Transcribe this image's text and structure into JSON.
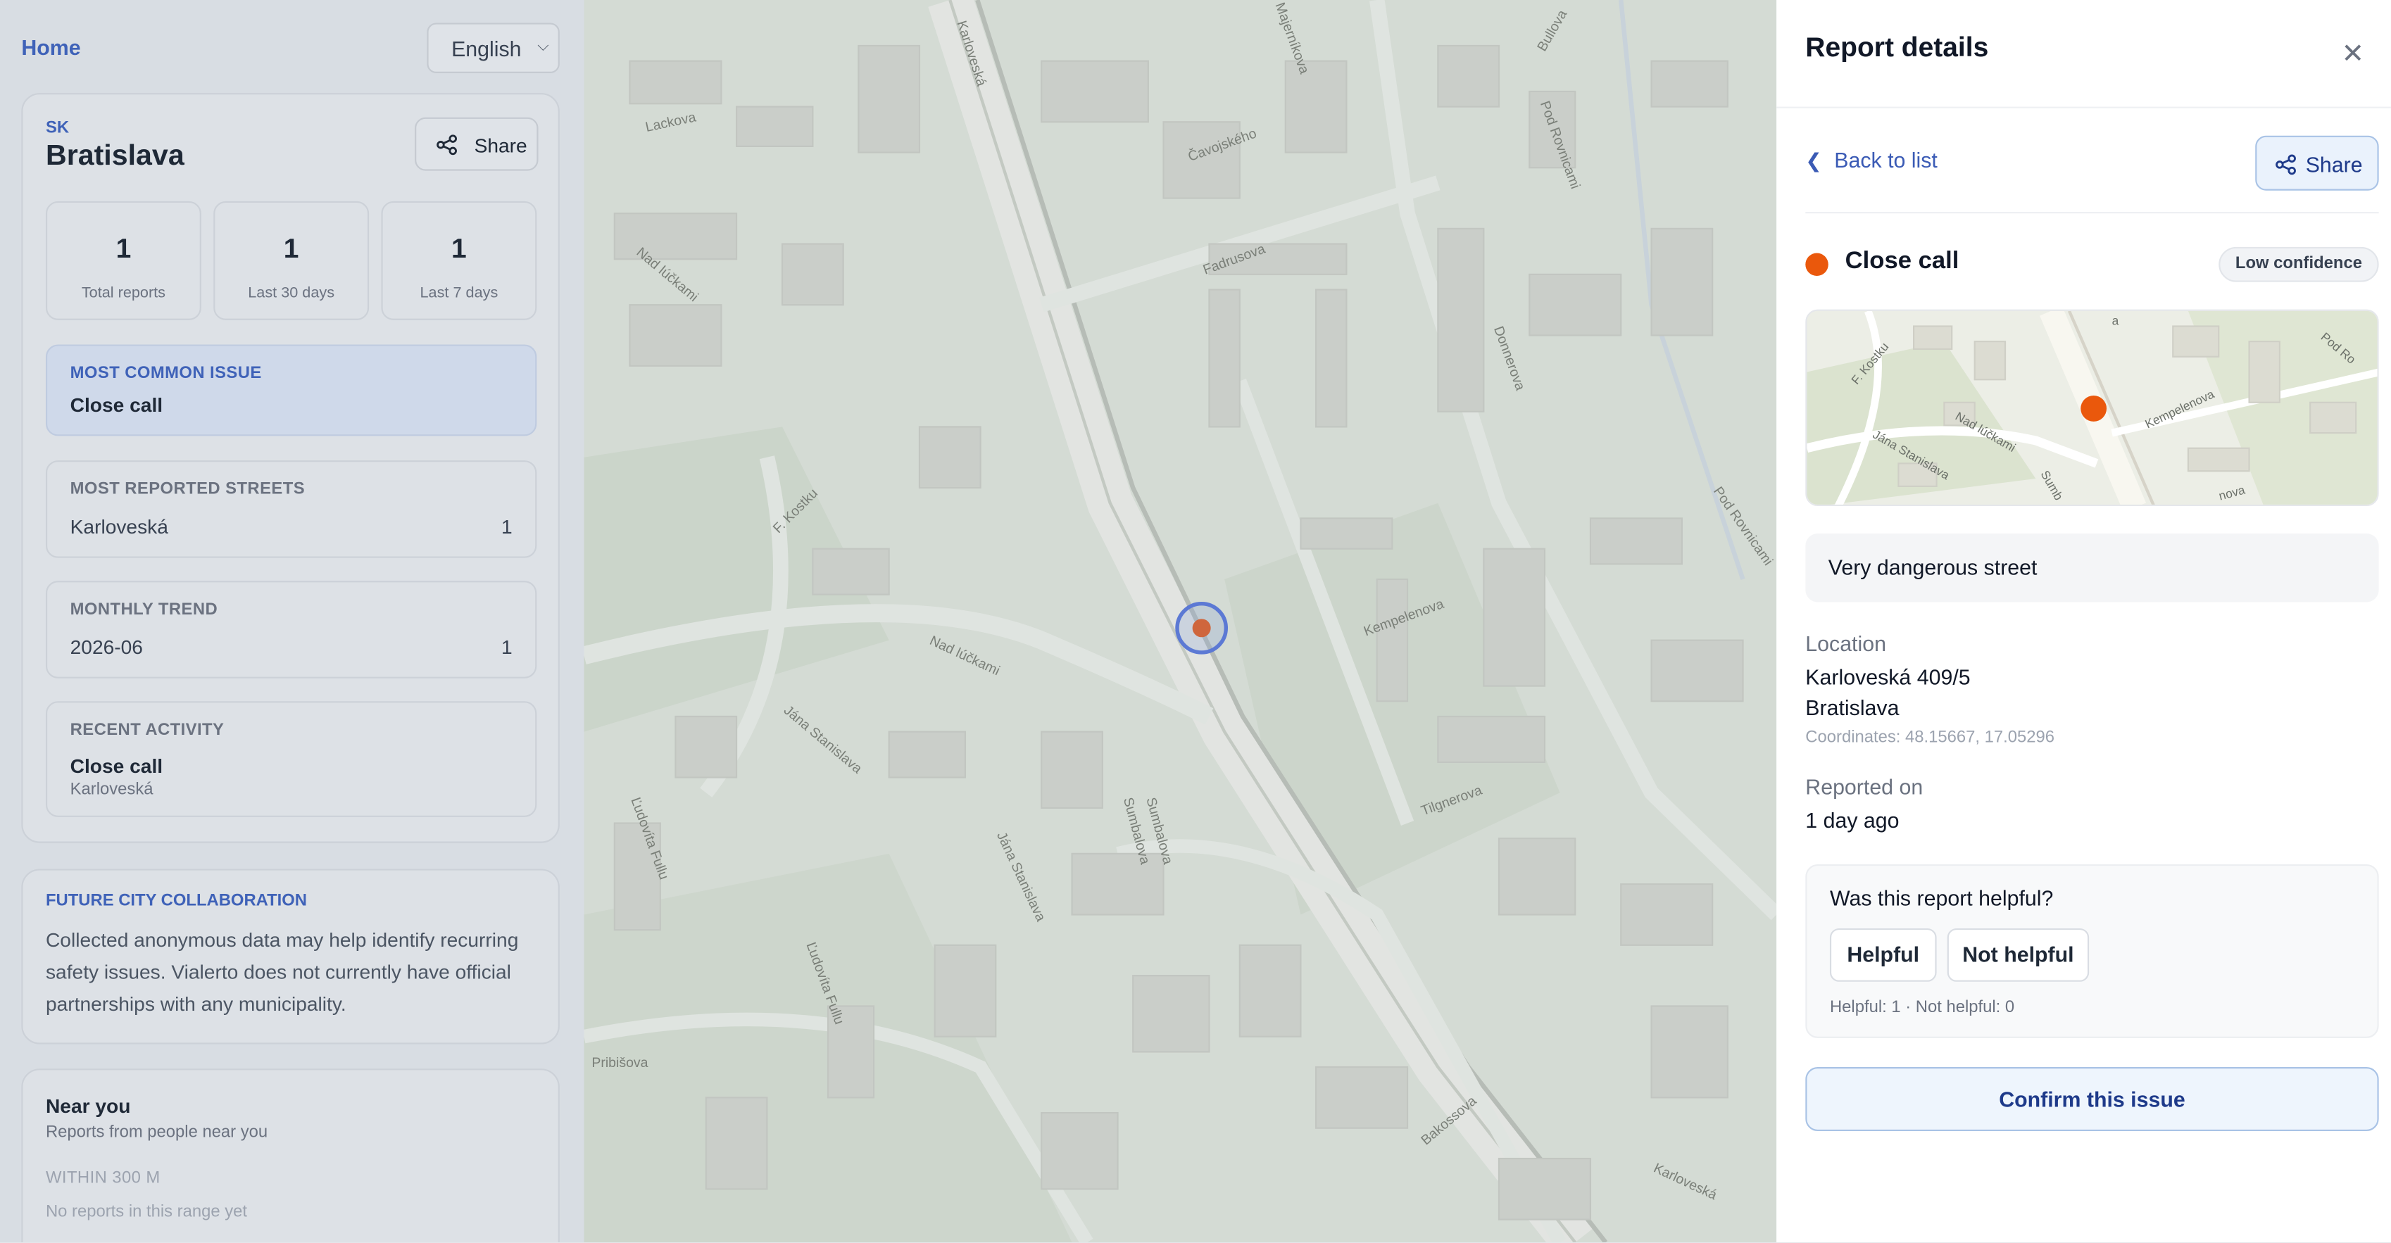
{
  "app": {
    "home_label": "Home",
    "language": "English"
  },
  "city": {
    "country_code": "SK",
    "name": "Bratislava",
    "share_label": "Share",
    "stats": [
      {
        "value": "1",
        "label": "Total reports"
      },
      {
        "value": "1",
        "label": "Last 30 days"
      },
      {
        "value": "1",
        "label": "Last 7 days"
      }
    ],
    "most_common_issue": {
      "title": "MOST COMMON ISSUE",
      "value": "Close call"
    },
    "most_reported_streets": {
      "title": "MOST REPORTED STREETS",
      "rows": [
        {
          "name": "Karloveská",
          "count": "1"
        }
      ]
    },
    "monthly_trend": {
      "title": "MONTHLY TREND",
      "rows": [
        {
          "name": "2026-06",
          "count": "1"
        }
      ]
    },
    "recent_activity": {
      "title": "RECENT ACTIVITY",
      "items": [
        {
          "title": "Close call",
          "street": "Karloveská"
        }
      ]
    }
  },
  "collaboration": {
    "title": "FUTURE CITY COLLABORATION",
    "text": "Collected anonymous data may help identify recurring safety issues. Vialerto does not currently have official partnerships with any municipality."
  },
  "near_you": {
    "title": "Near you",
    "subtitle": "Reports from people near you",
    "range_label": "WITHIN 300 M",
    "empty_text": "No reports in this range yet"
  },
  "map": {
    "street_labels": [
      "Karloveská",
      "Lackova",
      "Nad lúčkami",
      "F. Kostku",
      "Jána Stanislava",
      "Ľudovíta Fullu",
      "Fadrusova",
      "Kempelenova",
      "Tilgnerova",
      "Sumbalova",
      "Čavojského",
      "Pribišova",
      "Ľudovíta Fullu",
      "Jána Stanislava",
      "Nad lúčkami",
      "Bakossova",
      "Donnerova",
      "Pod Rovnicami",
      "Bullova",
      "Majerníkova",
      "Pod Rovnicami",
      "Sumbalova",
      "Karloveská"
    ]
  },
  "report": {
    "panel_title": "Report details",
    "back_label": "Back to list",
    "share_label": "Share",
    "type": "Close call",
    "confidence": "Low confidence",
    "description": "Very dangerous street",
    "location_label": "Location",
    "address": "Karloveská 409/5",
    "city": "Bratislava",
    "coordinates": "Coordinates: 48.15667, 17.05296",
    "reported_label": "Reported on",
    "reported_value": "1 day ago",
    "feedback": {
      "question": "Was this report helpful?",
      "helpful_label": "Helpful",
      "not_helpful_label": "Not helpful",
      "counts": "Helpful: 1 · Not helpful: 0"
    },
    "confirm_label": "Confirm this issue",
    "mini_map_labels": [
      "F. Kostku",
      "Nad lúčkami",
      "Jána Stanislava",
      "Kempelenova",
      "Sumb",
      "Pod Ro",
      "nova",
      "a"
    ]
  },
  "colors": {
    "accent": "#3f62b8",
    "marker": "#ea580c",
    "confirm_text": "#1e3a8a"
  },
  "icons": {
    "share": "share-icon",
    "close": "close-icon",
    "back": "chevron-left-icon",
    "select": "chevron-down-icon"
  }
}
